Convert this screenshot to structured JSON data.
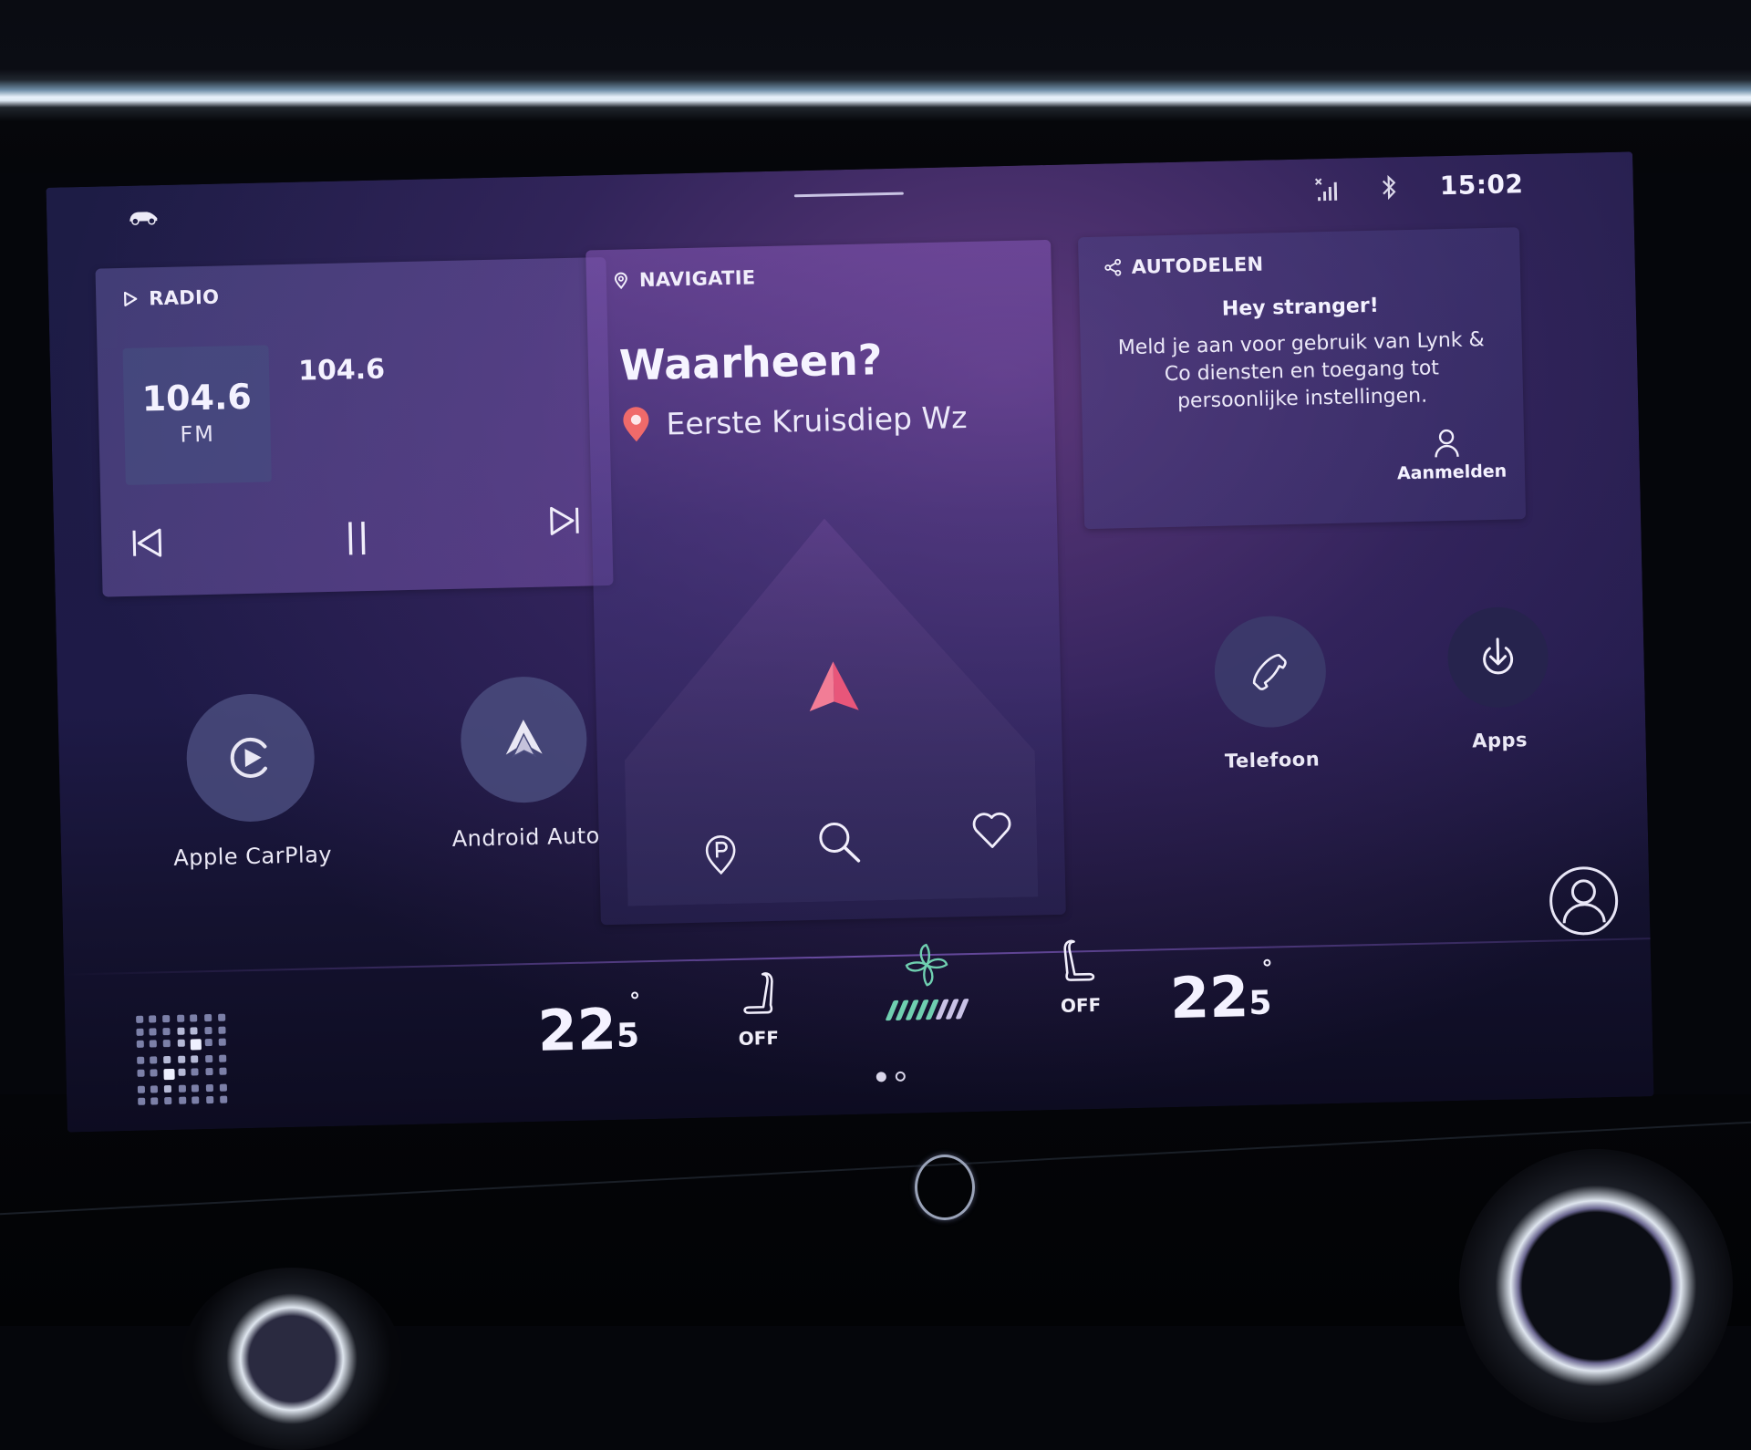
{
  "colors": {
    "accent_nav_arrow": "#f06a8a",
    "destination_pin": "#f06a6a",
    "fan_active": "#6fcfb0",
    "fan_inactive": "#c9c2e6",
    "text_primary": "#f4f2ff"
  },
  "status_bar": {
    "left_icon": "car-status-icon",
    "icons": [
      "no-signal-icon",
      "bluetooth-icon"
    ],
    "time": "15:02"
  },
  "radio": {
    "title": "RADIO",
    "title_icon": "play-outline-icon",
    "station_frequency": "104.6",
    "station_band": "FM",
    "now_playing": "104.6",
    "controls": [
      "previous-icon",
      "pause-icon",
      "next-icon"
    ]
  },
  "navigation": {
    "title": "NAVIGATIE",
    "title_icon": "location-outline-icon",
    "heading": "Waarheen?",
    "destination": "Eerste Kruisdiep Wz",
    "tools": [
      "parking-icon",
      "search-icon",
      "heart-icon"
    ],
    "pages": {
      "current": 1,
      "total": 2
    }
  },
  "car_sharing": {
    "title": "AUTODELEN",
    "title_icon": "share-icon",
    "greeting": "Hey stranger!",
    "message": "Meld je aan voor gebruik van Lynk & Co diensten en toegang tot persoonlijke instellingen.",
    "login_label": "Aanmelden"
  },
  "apps": [
    {
      "label": "Apple CarPlay",
      "icon": "carplay-icon"
    },
    {
      "label": "Android Auto",
      "icon": "android-auto-icon"
    },
    {
      "label": "Telefoon",
      "icon": "phone-icon"
    },
    {
      "label": "Apps",
      "icon": "download-icon"
    }
  ],
  "climate": {
    "left_temp": {
      "whole": "22",
      "decimal": "5",
      "unit": "°"
    },
    "right_temp": {
      "whole": "22",
      "decimal": "5",
      "unit": "°"
    },
    "left_seat": "OFF",
    "right_seat": "OFF",
    "fan_level": 5,
    "fan_levels_total": 8
  }
}
